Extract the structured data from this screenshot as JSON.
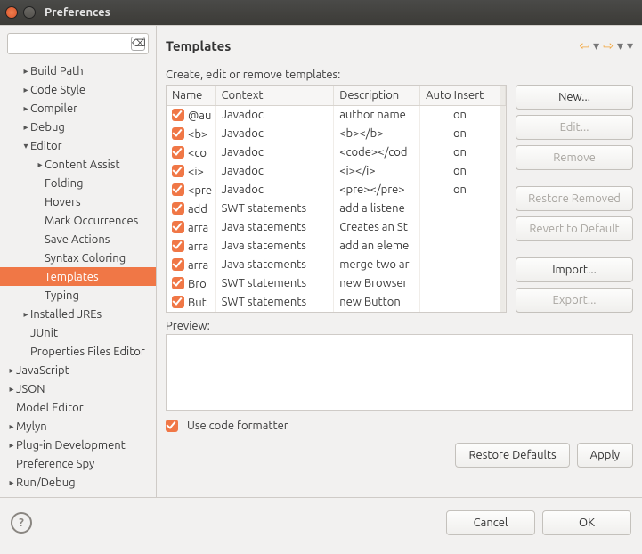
{
  "window": {
    "title": "Preferences"
  },
  "search": {
    "value": "",
    "placeholder": ""
  },
  "tree": [
    {
      "label": "Build Path",
      "depth": 1,
      "arrow": "▸",
      "sel": false
    },
    {
      "label": "Code Style",
      "depth": 1,
      "arrow": "▸",
      "sel": false
    },
    {
      "label": "Compiler",
      "depth": 1,
      "arrow": "▸",
      "sel": false
    },
    {
      "label": "Debug",
      "depth": 1,
      "arrow": "▸",
      "sel": false
    },
    {
      "label": "Editor",
      "depth": 1,
      "arrow": "▾",
      "sel": false
    },
    {
      "label": "Content Assist",
      "depth": 2,
      "arrow": "▸",
      "sel": false
    },
    {
      "label": "Folding",
      "depth": 2,
      "arrow": "",
      "sel": false
    },
    {
      "label": "Hovers",
      "depth": 2,
      "arrow": "",
      "sel": false
    },
    {
      "label": "Mark Occurrences",
      "depth": 2,
      "arrow": "",
      "sel": false
    },
    {
      "label": "Save Actions",
      "depth": 2,
      "arrow": "",
      "sel": false
    },
    {
      "label": "Syntax Coloring",
      "depth": 2,
      "arrow": "",
      "sel": false
    },
    {
      "label": "Templates",
      "depth": 2,
      "arrow": "",
      "sel": true
    },
    {
      "label": "Typing",
      "depth": 2,
      "arrow": "",
      "sel": false
    },
    {
      "label": "Installed JREs",
      "depth": 1,
      "arrow": "▸",
      "sel": false
    },
    {
      "label": "JUnit",
      "depth": 1,
      "arrow": "",
      "sel": false
    },
    {
      "label": "Properties Files Editor",
      "depth": 1,
      "arrow": "",
      "sel": false
    },
    {
      "label": "JavaScript",
      "depth": 0,
      "arrow": "▸",
      "sel": false
    },
    {
      "label": "JSON",
      "depth": 0,
      "arrow": "▸",
      "sel": false
    },
    {
      "label": "Model Editor",
      "depth": 0,
      "arrow": "",
      "sel": false
    },
    {
      "label": "Mylyn",
      "depth": 0,
      "arrow": "▸",
      "sel": false
    },
    {
      "label": "Plug-in Development",
      "depth": 0,
      "arrow": "▸",
      "sel": false
    },
    {
      "label": "Preference Spy",
      "depth": 0,
      "arrow": "",
      "sel": false
    },
    {
      "label": "Run/Debug",
      "depth": 0,
      "arrow": "▸",
      "sel": false
    }
  ],
  "page": {
    "heading": "Templates",
    "subheading": "Create, edit or remove templates:",
    "columns": {
      "name": "Name",
      "context": "Context",
      "description": "Description",
      "auto": "Auto Insert"
    },
    "rows": [
      {
        "on": true,
        "name": "@au",
        "context": "Javadoc",
        "desc": "author name",
        "auto": "on"
      },
      {
        "on": true,
        "name": "<b>",
        "context": "Javadoc",
        "desc": "<b></b>",
        "auto": "on"
      },
      {
        "on": true,
        "name": "<co",
        "context": "Javadoc",
        "desc": "<code></cod",
        "auto": "on"
      },
      {
        "on": true,
        "name": "<i>",
        "context": "Javadoc",
        "desc": "<i></i>",
        "auto": "on"
      },
      {
        "on": true,
        "name": "<pre",
        "context": "Javadoc",
        "desc": "<pre></pre>",
        "auto": "on"
      },
      {
        "on": true,
        "name": "add",
        "context": "SWT statements",
        "desc": "add a listene",
        "auto": ""
      },
      {
        "on": true,
        "name": "arra",
        "context": "Java statements",
        "desc": "Creates an St",
        "auto": ""
      },
      {
        "on": true,
        "name": "arra",
        "context": "Java statements",
        "desc": "add an eleme",
        "auto": ""
      },
      {
        "on": true,
        "name": "arra",
        "context": "Java statements",
        "desc": "merge two ar",
        "auto": ""
      },
      {
        "on": true,
        "name": "Bro",
        "context": "SWT statements",
        "desc": "new Browser",
        "auto": ""
      },
      {
        "on": true,
        "name": "But",
        "context": "SWT statements",
        "desc": "new Button",
        "auto": ""
      }
    ],
    "buttons": {
      "new": "New...",
      "edit": "Edit...",
      "remove": "Remove",
      "restore_removed": "Restore Removed",
      "revert": "Revert to Default",
      "import": "Import...",
      "export": "Export..."
    },
    "preview_label": "Preview:",
    "use_formatter": "Use code formatter",
    "restore_defaults": "Restore Defaults",
    "apply": "Apply"
  },
  "footer": {
    "cancel": "Cancel",
    "ok": "OK"
  }
}
